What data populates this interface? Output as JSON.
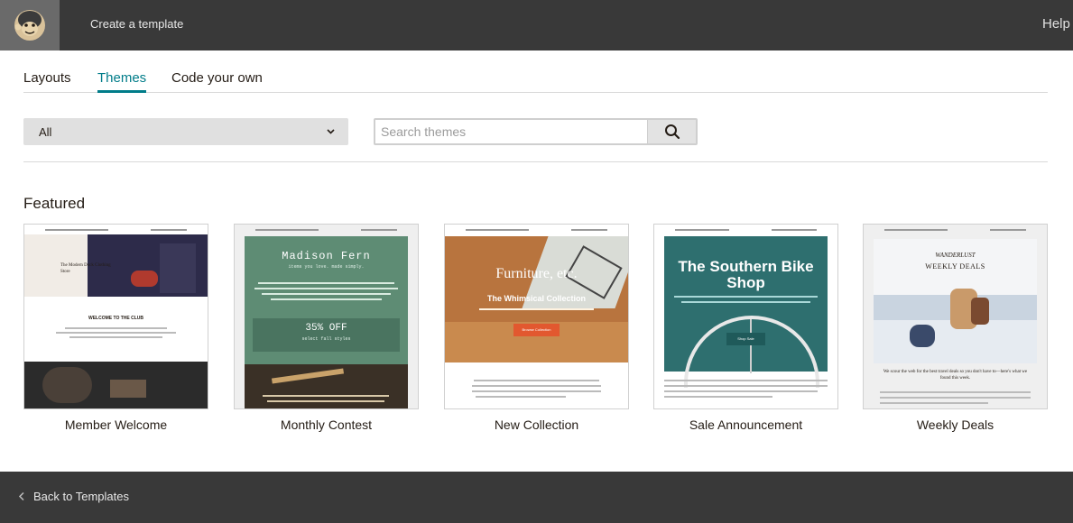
{
  "topbar": {
    "title": "Create a template",
    "help": "Help"
  },
  "tabs": [
    {
      "label": "Layouts",
      "active": false
    },
    {
      "label": "Themes",
      "active": true
    },
    {
      "label": "Code your own",
      "active": false
    }
  ],
  "filter": {
    "value": "All"
  },
  "search": {
    "placeholder": "Search themes"
  },
  "section": {
    "title": "Featured"
  },
  "templates": [
    {
      "name": "Member Welcome",
      "thumb_title": "The Modern Dock Clothing Store",
      "thumb_heading": "WELCOME TO THE CLUB"
    },
    {
      "name": "Monthly Contest",
      "thumb_title": "Madison Fern",
      "thumb_tagline": "items you love. made simply.",
      "thumb_offer": "35% OFF",
      "thumb_offer_sub": "select fall styles"
    },
    {
      "name": "New Collection",
      "thumb_title": "Furniture, etc.",
      "thumb_subtitle": "The Whimsical Collection",
      "thumb_button": "Browse Collection"
    },
    {
      "name": "Sale Announcement",
      "thumb_title": "The Southern Bike Shop",
      "thumb_button": "Shop Sale"
    },
    {
      "name": "Weekly Deals",
      "thumb_brand": "WANDERLUST",
      "thumb_title": "WEEKLY DEALS",
      "thumb_blurb": "We scour the web for the best travel deals so you don't have to—here's what we found this week."
    }
  ],
  "footer": {
    "back_label": "Back to Templates"
  },
  "colors": {
    "topbar": "#393939",
    "accent": "#007c89",
    "footer": "#393939"
  }
}
